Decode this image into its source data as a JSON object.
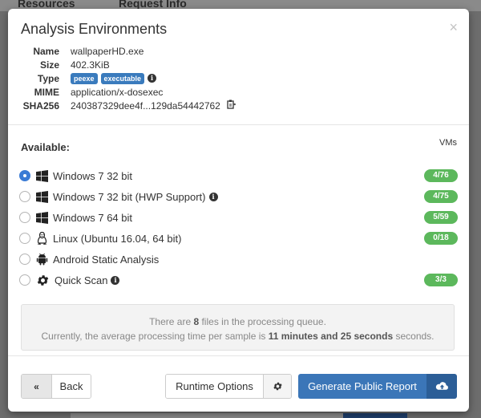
{
  "background": {
    "nav_resources": "Resources",
    "nav_request_info": "Request Info"
  },
  "modal": {
    "title": "Analysis Environments",
    "close_symbol": "×"
  },
  "file_info": {
    "name_label": "Name",
    "name_value": "wallpaperHD.exe",
    "size_label": "Size",
    "size_value": "402.3KiB",
    "type_label": "Type",
    "type_tags": [
      "peexe",
      "executable"
    ],
    "mime_label": "MIME",
    "mime_value": "application/x-dosexec",
    "sha_label": "SHA256",
    "sha_value": "240387329dee4f...129da54442762"
  },
  "available": {
    "label": "Available:",
    "vms_label": "VMs",
    "environments": [
      {
        "label": "Windows 7 32 bit",
        "icon": "windows-icon",
        "badge": "4/76",
        "selected": true
      },
      {
        "label": "Windows 7 32 bit (HWP Support)",
        "icon": "windows-icon",
        "badge": "4/75",
        "info": true
      },
      {
        "label": "Windows 7 64 bit",
        "icon": "windows-icon",
        "badge": "5/59"
      },
      {
        "label": "Linux (Ubuntu 16.04, 64 bit)",
        "icon": "linux-icon",
        "badge": "0/18"
      },
      {
        "label": "Android Static Analysis",
        "icon": "android-icon",
        "badge": ""
      },
      {
        "label": "Quick Scan",
        "icon": "gear-icon",
        "badge": "3/3",
        "info": true
      }
    ]
  },
  "queue": {
    "line1_pre": "There are ",
    "line1_count": "8",
    "line1_post": " files in the processing queue.",
    "line2_pre": "Currently, the average processing time per sample is ",
    "line2_time": "11 minutes and 25 seconds",
    "line2_post": " seconds."
  },
  "footer": {
    "back_icon": "«",
    "back_label": "Back",
    "runtime_label": "Runtime Options",
    "report_label": "Generate Public Report"
  },
  "colors": {
    "accent": "#3b76b8",
    "badge_green": "#5cb85c",
    "tag_blue": "#3a7bbd"
  }
}
